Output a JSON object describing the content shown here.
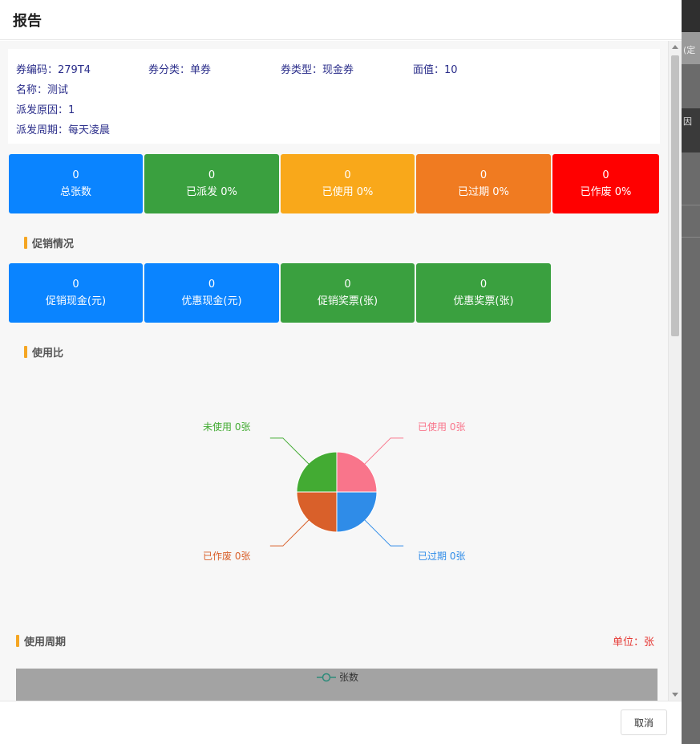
{
  "dialog": {
    "title": "报告",
    "cancel_label": "取消"
  },
  "background": {
    "fragment1": "(定",
    "fragment2": "因"
  },
  "info": {
    "code": "券编码：279T4",
    "category": "券分类：单券",
    "type": "券类型：现金券",
    "face_value": "面值：10",
    "name": "名称：测试",
    "reason": "派发原因：1",
    "period": "派发周期：每天凌晨"
  },
  "stats": [
    {
      "value": "0",
      "label": "总张数",
      "color": "#0a84ff"
    },
    {
      "value": "0",
      "label": "已派发 0%",
      "color": "#3aa03f"
    },
    {
      "value": "0",
      "label": "已使用 0%",
      "color": "#f9a81a"
    },
    {
      "value": "0",
      "label": "已过期 0%",
      "color": "#f07b21"
    },
    {
      "value": "0",
      "label": "已作废 0%",
      "color": "#ff0000"
    }
  ],
  "promo_section": {
    "title": "促销情况"
  },
  "promo_stats": [
    {
      "value": "0",
      "label": "促销现金(元)",
      "color": "#0a84ff"
    },
    {
      "value": "0",
      "label": "优惠现金(元)",
      "color": "#0a84ff"
    },
    {
      "value": "0",
      "label": "促销奖票(张)",
      "color": "#3aa03f"
    },
    {
      "value": "0",
      "label": "优惠奖票(张)",
      "color": "#3aa03f"
    }
  ],
  "usage_section": {
    "title": "使用比"
  },
  "cycle_section": {
    "title": "使用周期",
    "unit": "单位：张",
    "legend": "张数"
  },
  "chart_data": {
    "type": "pie",
    "slices": [
      {
        "label": "已使用 0张",
        "value": 0,
        "color": "#f9758b"
      },
      {
        "label": "已过期 0张",
        "value": 0,
        "color": "#2f8ce8"
      },
      {
        "label": "已作废 0张",
        "value": 0,
        "color": "#d9602a"
      },
      {
        "label": "未使用 0张",
        "value": 0,
        "color": "#43ab33"
      }
    ]
  }
}
